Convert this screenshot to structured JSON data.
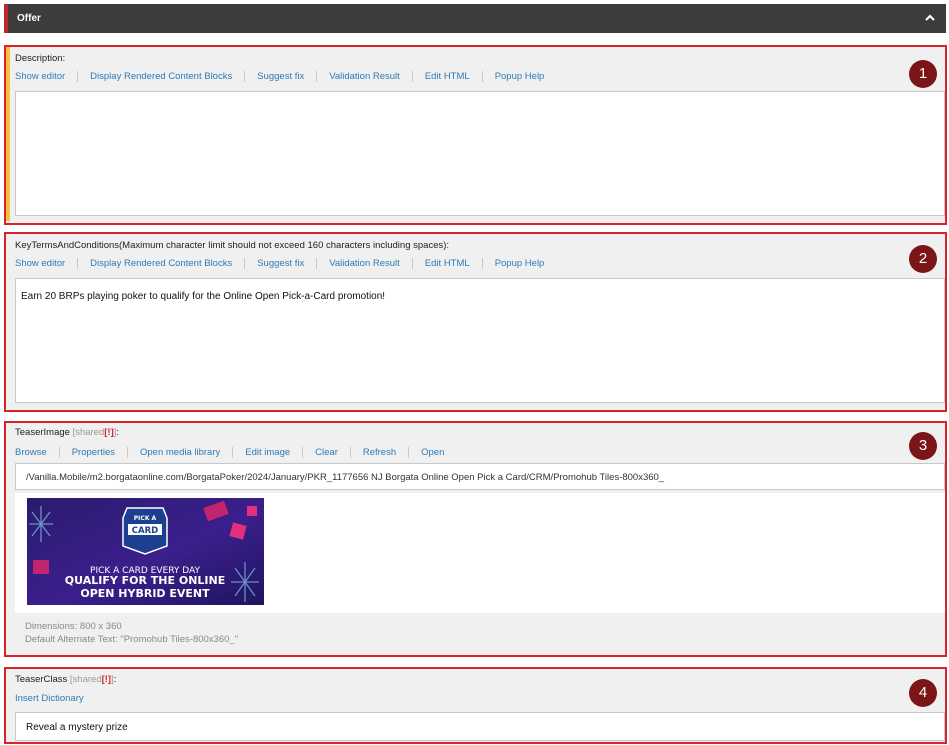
{
  "header": {
    "title": "Offer",
    "collapse_icon": "chevron-up-icon"
  },
  "description": {
    "label": "Description:",
    "links": [
      "Show editor",
      "Display Rendered Content Blocks",
      "Suggest fix",
      "Validation Result",
      "Edit HTML",
      "Popup Help"
    ],
    "value": "",
    "badge": "1"
  },
  "key_terms": {
    "label": "KeyTermsAndConditions(Maximum character limit should not exceed 160 characters including spaces):",
    "links": [
      "Show editor",
      "Display Rendered Content Blocks",
      "Suggest fix",
      "Validation Result",
      "Edit HTML",
      "Popup Help"
    ],
    "value": "Earn 20 BRPs playing poker to qualify for the Online Open Pick-a-Card promotion!",
    "badge": "2"
  },
  "teaser_image": {
    "label": "TeaserImage",
    "shared": "[shared",
    "excl": "[!]",
    "shared_close": "]",
    "colon": ":",
    "links": [
      "Browse",
      "Properties",
      "Open media library",
      "Edit image",
      "Clear",
      "Refresh",
      "Open"
    ],
    "path": "/Vanilla.Mobile/m2.borgataonline.com/BorgataPoker/2024/January/PKR_1177656 NJ Borgata Online Open Pick a Card/CRM/Promohub Tiles-800x360_",
    "image_text": {
      "badge_line1": "PICK A",
      "badge_line2": "CARD",
      "line1": "PICK A CARD EVERY DAY",
      "line2": "QUALIFY FOR THE ONLINE",
      "line3": "OPEN HYBRID EVENT"
    },
    "dimensions": "Dimensions: 800 x 360",
    "alt_text": "Default Alternate Text: \"Promohub Tiles-800x360_\"",
    "badge": "3"
  },
  "teaser_class": {
    "label": "TeaserClass",
    "shared": "[shared",
    "excl": "[!]",
    "shared_close": "]",
    "colon": ":",
    "links": [
      "Insert Dictionary"
    ],
    "value": "Reveal a mystery prize",
    "badge": "4"
  },
  "colors": {
    "accent_red": "#d9222a",
    "link_blue": "#2d7bb6",
    "badge_red": "#7b1518",
    "header_bg": "#3c3c3c"
  }
}
